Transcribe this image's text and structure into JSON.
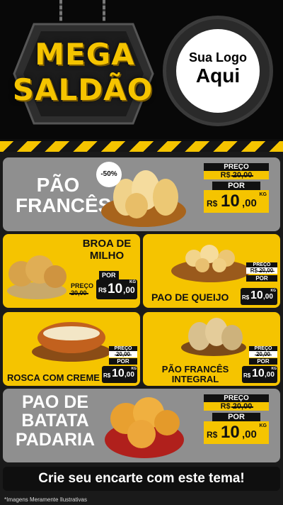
{
  "header": {
    "title_line1": "MEGA",
    "title_line2": "SALDÃO",
    "logo_line1": "Sua Logo",
    "logo_line2": "Aqui"
  },
  "labels": {
    "preco": "PREÇO",
    "por": "POR",
    "currency": "R$",
    "kg": "KG"
  },
  "products": [
    {
      "name_l1": "PÃO",
      "name_l2": "FRANCÊS",
      "discount": "-50%",
      "old_price": "20,00",
      "price_int": "10",
      "price_dec": ",00"
    },
    {
      "name_l1": "BROA DE",
      "name_l2": "MILHO",
      "old_price": "20,00",
      "price_int": "10",
      "price_dec": ",00"
    },
    {
      "name_l1": "PAO DE QUEIJO",
      "old_price": "20,00",
      "price_int": "10",
      "price_dec": ",00"
    },
    {
      "name_l1": "ROSCA COM CREME",
      "old_price": "20,00",
      "price_int": "10",
      "price_dec": ",00"
    },
    {
      "name_l1": "PÃO FRANCÊS",
      "name_l2": "INTEGRAL",
      "old_price": "20,00",
      "price_int": "10",
      "price_dec": ",00"
    },
    {
      "name_l1": "PAO DE",
      "name_l2": "BATATA",
      "name_l3": "PADARIA",
      "old_price": "20,00",
      "price_int": "10",
      "price_dec": ",00"
    }
  ],
  "cta": "Crie seu encarte com este tema!",
  "footnote": "*Imagens Meramente Ilustrativas",
  "colors": {
    "accent": "#f5c400",
    "card_gray": "#8f8f8f",
    "dark": "#111111"
  }
}
